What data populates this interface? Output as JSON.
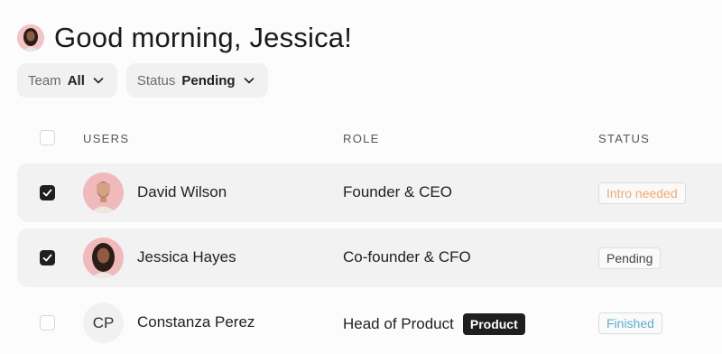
{
  "header": {
    "greeting": "Good morning, Jessica!"
  },
  "filters": [
    {
      "label": "Team",
      "value": "All"
    },
    {
      "label": "Status",
      "value": "Pending"
    }
  ],
  "table": {
    "columns": {
      "users": "USERS",
      "role": "ROLE",
      "status": "STATUS"
    },
    "rows": [
      {
        "name": "David Wilson",
        "role": "Founder & CEO",
        "status": "Intro needed",
        "checked": true,
        "status_color": "#f0a970"
      },
      {
        "name": "Jessica Hayes",
        "role": "Co-founder & CFO",
        "status": "Pending",
        "checked": true,
        "status_color": "#444444"
      },
      {
        "name": "Constanza Perez",
        "initials": "CP",
        "role": "Head of Product",
        "tag": "Product",
        "status": "Finished",
        "checked": false,
        "status_color": "#5aaed0"
      }
    ]
  },
  "colors": {
    "accent": "#1f1f1f",
    "row_selected_bg": "#f2f2f2",
    "avatar_bg": "#f2c4c6"
  }
}
